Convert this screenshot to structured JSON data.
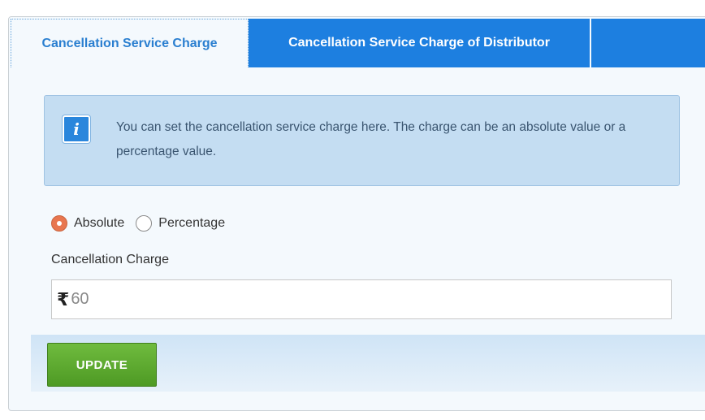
{
  "tabs": [
    {
      "label": "Cancellation Service Charge",
      "active": true
    },
    {
      "label": "Cancellation Service Charge of Distributor",
      "active": false
    }
  ],
  "info": {
    "icon": "info-icon",
    "text": "You can set the cancellation service charge here. The charge can be an absolute value or a percentage value."
  },
  "charge_type": {
    "options": [
      {
        "label": "Absolute",
        "checked": true
      },
      {
        "label": "Percentage",
        "checked": false
      }
    ]
  },
  "cancellation_charge": {
    "label": "Cancellation Charge",
    "currency_symbol": "₹",
    "value": "60"
  },
  "update_button": {
    "label": "UPDATE"
  },
  "colors": {
    "tab_active_text": "#2a7fd0",
    "tab_inactive_bg": "#1d7fe0",
    "radio_checked": "#e8764f",
    "update_button": "#5aa82d"
  }
}
